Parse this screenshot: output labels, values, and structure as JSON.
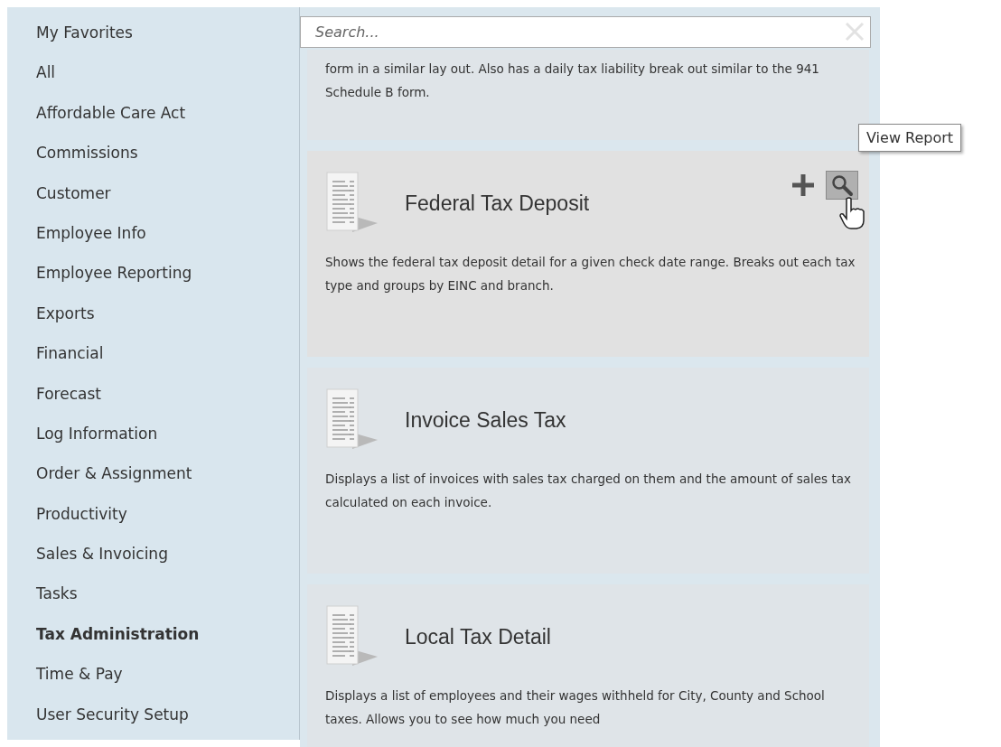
{
  "sidebar": {
    "items": [
      {
        "label": "My Favorites",
        "selected": false
      },
      {
        "label": "All",
        "selected": false
      },
      {
        "label": "Affordable Care Act",
        "selected": false
      },
      {
        "label": "Commissions",
        "selected": false
      },
      {
        "label": "Customer",
        "selected": false
      },
      {
        "label": "Employee Info",
        "selected": false
      },
      {
        "label": "Employee Reporting",
        "selected": false
      },
      {
        "label": "Exports",
        "selected": false
      },
      {
        "label": "Financial",
        "selected": false
      },
      {
        "label": "Forecast",
        "selected": false
      },
      {
        "label": "Log Information",
        "selected": false
      },
      {
        "label": "Order & Assignment",
        "selected": false
      },
      {
        "label": "Productivity",
        "selected": false
      },
      {
        "label": "Sales & Invoicing",
        "selected": false
      },
      {
        "label": "Tasks",
        "selected": false
      },
      {
        "label": "Tax Administration",
        "selected": true
      },
      {
        "label": "Time & Pay",
        "selected": false
      },
      {
        "label": "User Security Setup",
        "selected": false
      }
    ]
  },
  "search": {
    "placeholder": "Search..."
  },
  "reports": [
    {
      "description": "form in a similar lay out.  Also has a daily tax liability break out similar to the 941 Schedule B form.",
      "hovered": false
    },
    {
      "title": "Federal Tax Deposit",
      "description": "Shows the federal tax deposit detail for a given check date range. Breaks out each tax type and groups by EINC and branch.",
      "hovered": true
    },
    {
      "title": "Invoice Sales Tax",
      "description": "Displays a list of invoices with sales tax charged on them and the amount of sales tax calculated on each invoice.",
      "hovered": false
    },
    {
      "title": "Local Tax Detail",
      "description": "Displays a list of employees and their wages withheld for City, County and School taxes.  Allows you to see how much you need",
      "hovered": false
    }
  ],
  "tooltip": {
    "text": "View Report"
  }
}
